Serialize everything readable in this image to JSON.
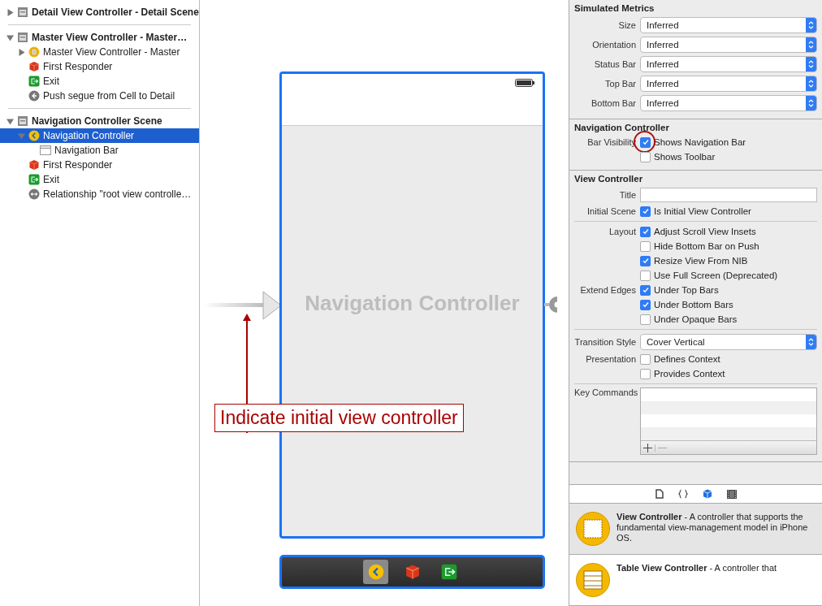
{
  "outline": {
    "scenes": [
      {
        "title": "Detail View Controller - Detail Scene",
        "expanded": false
      },
      {
        "title": "Master View Controller - Master…",
        "expanded": true,
        "children": [
          {
            "label": "Master View Controller - Master",
            "kind": "view-controller",
            "expanded": false,
            "selected": false
          },
          {
            "label": "First Responder",
            "kind": "first-responder",
            "selected": false
          },
          {
            "label": "Exit",
            "kind": "exit",
            "selected": false
          },
          {
            "label": "Push segue from Cell to Detail",
            "kind": "segue",
            "selected": false
          }
        ]
      },
      {
        "title": "Navigation Controller Scene",
        "expanded": true,
        "children": [
          {
            "label": "Navigation Controller",
            "kind": "navigation-controller",
            "expanded": true,
            "selected": true,
            "children": [
              {
                "label": "Navigation Bar",
                "kind": "navigation-bar",
                "selected": false
              }
            ]
          },
          {
            "label": "First Responder",
            "kind": "first-responder",
            "selected": false
          },
          {
            "label": "Exit",
            "kind": "exit",
            "selected": false
          },
          {
            "label": "Relationship \"root view controlle…",
            "kind": "relationship",
            "selected": false
          }
        ]
      }
    ]
  },
  "canvas": {
    "scene_title": "Navigation Controller",
    "annotation": "Indicate initial view controller",
    "dock": [
      {
        "kind": "navigation-controller",
        "selected": true
      },
      {
        "kind": "first-responder",
        "selected": false
      },
      {
        "kind": "exit",
        "selected": false
      }
    ]
  },
  "inspector": {
    "sections": [
      {
        "title": "Simulated Metrics",
        "groups": [
          [
            {
              "kind": "select",
              "label": "Size",
              "value": "Inferred"
            },
            {
              "kind": "select",
              "label": "Orientation",
              "value": "Inferred"
            },
            {
              "kind": "select",
              "label": "Status Bar",
              "value": "Inferred"
            },
            {
              "kind": "select",
              "label": "Top Bar",
              "value": "Inferred"
            },
            {
              "kind": "select",
              "label": "Bottom Bar",
              "value": "Inferred"
            }
          ]
        ]
      },
      {
        "title": "Navigation Controller",
        "groups": [
          [
            {
              "kind": "check",
              "label": "Bar Visibility",
              "text": "Shows Navigation Bar",
              "checked": true,
              "circled": true
            },
            {
              "kind": "check",
              "text": "Shows Toolbar",
              "checked": false
            }
          ]
        ]
      },
      {
        "title": "View Controller",
        "groups": [
          [
            {
              "kind": "text",
              "label": "Title"
            },
            {
              "kind": "check",
              "label": "Initial Scene",
              "text": "Is Initial View Controller",
              "checked": true
            }
          ],
          [
            {
              "kind": "check",
              "label": "Layout",
              "text": "Adjust Scroll View Insets",
              "checked": true
            },
            {
              "kind": "check",
              "text": "Hide Bottom Bar on Push",
              "checked": false
            },
            {
              "kind": "check",
              "text": "Resize View From NIB",
              "checked": true
            },
            {
              "kind": "check",
              "text": "Use Full Screen (Deprecated)",
              "checked": false
            },
            {
              "kind": "check",
              "label": "Extend Edges",
              "text": "Under Top Bars",
              "checked": true
            },
            {
              "kind": "check",
              "text": "Under Bottom Bars",
              "checked": true
            },
            {
              "kind": "check",
              "text": "Under Opaque Bars",
              "checked": false
            }
          ],
          [
            {
              "kind": "select",
              "label": "Transition Style",
              "value": "Cover Vertical"
            },
            {
              "kind": "check",
              "label": "Presentation",
              "text": "Defines Context",
              "checked": false
            },
            {
              "kind": "check",
              "text": "Provides Context",
              "checked": false
            }
          ],
          [
            {
              "kind": "table",
              "label": "Key Commands"
            }
          ]
        ]
      }
    ]
  },
  "library": {
    "tabs": [
      {
        "kind": "file",
        "selected": false
      },
      {
        "kind": "braces",
        "selected": false
      },
      {
        "kind": "cube",
        "selected": true
      },
      {
        "kind": "film",
        "selected": false
      }
    ],
    "items": [
      {
        "kind": "view-controller",
        "description": "**View Controller** - A controller that supports the fundamental view-management model in iPhone OS.",
        "selected": true
      },
      {
        "kind": "table-view-controller",
        "description": "**Table View Controller** - A controller that",
        "selected": false
      }
    ]
  }
}
